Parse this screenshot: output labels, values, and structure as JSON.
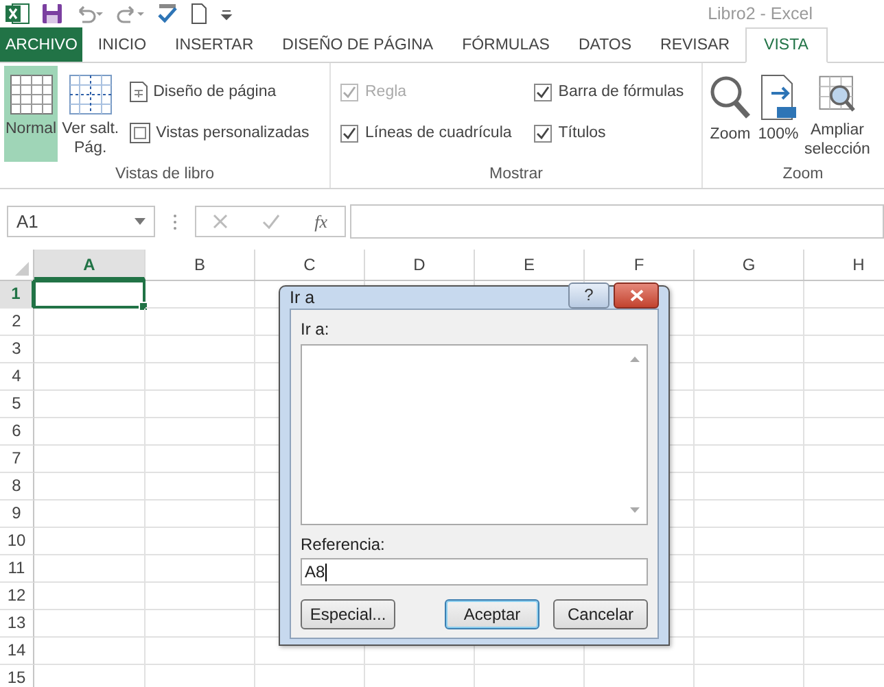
{
  "window": {
    "title": "Libro2 - Excel"
  },
  "tabs": [
    {
      "label": "ARCHIVO",
      "kind": "file",
      "selected": false
    },
    {
      "label": "INICIO",
      "kind": "tab",
      "selected": false
    },
    {
      "label": "INSERTAR",
      "kind": "tab",
      "selected": false
    },
    {
      "label": "DISEÑO DE PÁGINA",
      "kind": "tab",
      "selected": false
    },
    {
      "label": "FÓRMULAS",
      "kind": "tab",
      "selected": false
    },
    {
      "label": "DATOS",
      "kind": "tab",
      "selected": false
    },
    {
      "label": "REVISAR",
      "kind": "tab",
      "selected": false
    },
    {
      "label": "VISTA",
      "kind": "tab",
      "selected": true
    }
  ],
  "ribbon": {
    "groups": [
      {
        "label": "Vistas de libro",
        "items": [
          {
            "kind": "large-button",
            "label": "Normal",
            "selected": true
          },
          {
            "kind": "large-button",
            "label": "Ver salt.\nPág.",
            "selected": false
          },
          {
            "kind": "small-button",
            "label": "Diseño de página"
          },
          {
            "kind": "small-button",
            "label": "Vistas personalizadas"
          }
        ]
      },
      {
        "label": "Mostrar",
        "items": [
          {
            "kind": "checkbox",
            "label": "Regla",
            "checked": true,
            "disabled": true
          },
          {
            "kind": "checkbox",
            "label": "Líneas de cuadrícula",
            "checked": true,
            "disabled": false
          },
          {
            "kind": "checkbox",
            "label": "Barra de fórmulas",
            "checked": true,
            "disabled": false
          },
          {
            "kind": "checkbox",
            "label": "Títulos",
            "checked": true,
            "disabled": false
          }
        ]
      },
      {
        "label": "Zoom",
        "items": [
          {
            "kind": "large-button",
            "label": "Zoom",
            "selected": false
          },
          {
            "kind": "large-button",
            "label": "100%",
            "selected": false
          },
          {
            "kind": "large-button",
            "label": "Ampliar\nselección",
            "selected": false
          }
        ]
      }
    ]
  },
  "name_box": {
    "value": "A1"
  },
  "formula_bar": {
    "function_label": "fx"
  },
  "grid": {
    "columns": [
      {
        "label": "A",
        "selected": true
      },
      {
        "label": "B",
        "selected": false
      },
      {
        "label": "C",
        "selected": false
      },
      {
        "label": "D",
        "selected": false
      },
      {
        "label": "E",
        "selected": false
      },
      {
        "label": "F",
        "selected": false
      },
      {
        "label": "G",
        "selected": false
      },
      {
        "label": "H",
        "selected": false
      }
    ],
    "rows": [
      {
        "label": "1",
        "selected": true
      },
      {
        "label": "2",
        "selected": false
      },
      {
        "label": "3",
        "selected": false
      },
      {
        "label": "4",
        "selected": false
      },
      {
        "label": "5",
        "selected": false
      },
      {
        "label": "6",
        "selected": false
      },
      {
        "label": "7",
        "selected": false
      },
      {
        "label": "8",
        "selected": false
      },
      {
        "label": "9",
        "selected": false
      },
      {
        "label": "10",
        "selected": false
      },
      {
        "label": "11",
        "selected": false
      },
      {
        "label": "12",
        "selected": false
      },
      {
        "label": "13",
        "selected": false
      },
      {
        "label": "14",
        "selected": false
      },
      {
        "label": "15",
        "selected": false
      }
    ]
  },
  "dialog": {
    "title": "Ir a",
    "help_button": "?",
    "list_label": "Ir a:",
    "reference_label": "Referencia:",
    "reference_value": "A8",
    "buttons": [
      {
        "label": "Especial...",
        "default": false
      },
      {
        "label": "Aceptar",
        "default": true
      },
      {
        "label": "Cancelar",
        "default": false
      }
    ]
  }
}
